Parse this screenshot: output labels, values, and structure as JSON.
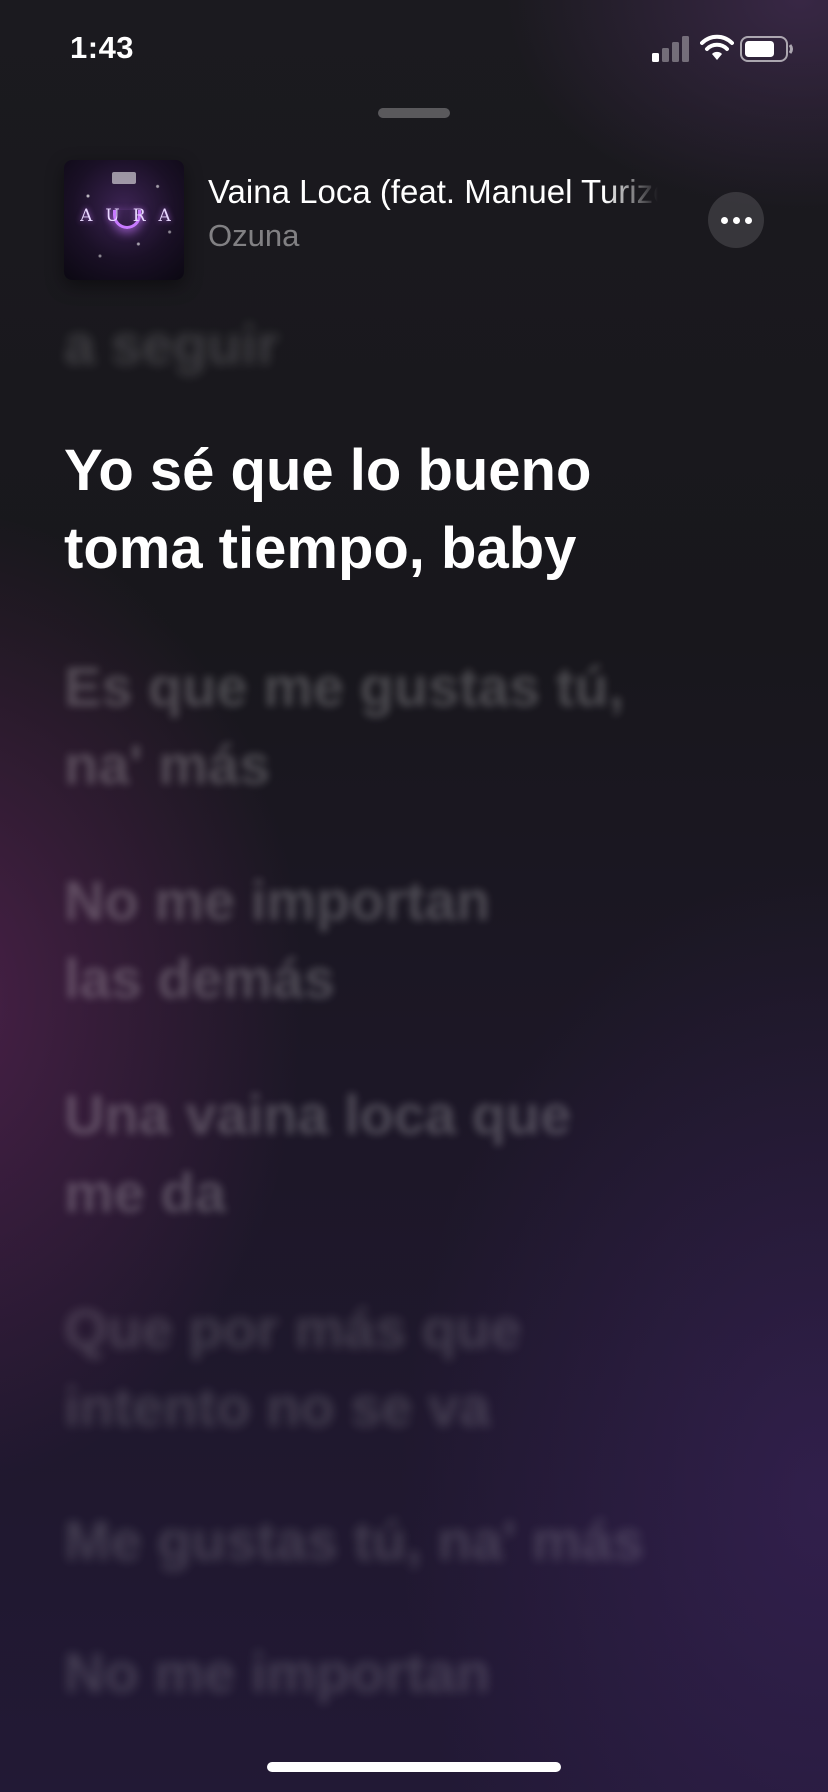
{
  "status_bar": {
    "time": "1:43",
    "signal_icon": "cellular-signal-icon",
    "wifi_icon": "wifi-icon",
    "battery_icon": "battery-icon"
  },
  "now_playing": {
    "album_art_text": "AURA",
    "title": "Vaina Loca (feat. Manuel Turizo)",
    "artist": "Ozuna",
    "more_icon": "ellipsis-icon"
  },
  "lyrics": {
    "previous_line": "a seguir",
    "current_line": "Yo sé que lo bueno\ntoma tiempo, baby",
    "upcoming": [
      "Es que me gustas tú,\nna' más",
      "No me importan\nlas demás",
      "Una vaina loca que\nme da",
      "Que por más que\nintento no se va",
      "Me gustas tú, na' más",
      "No me importan"
    ]
  },
  "colors": {
    "background_top": "#1b1a1f",
    "background_bottom": "#221935",
    "active_lyric": "#ffffff",
    "artist_text": "rgba(255,255,255,0.45)"
  }
}
